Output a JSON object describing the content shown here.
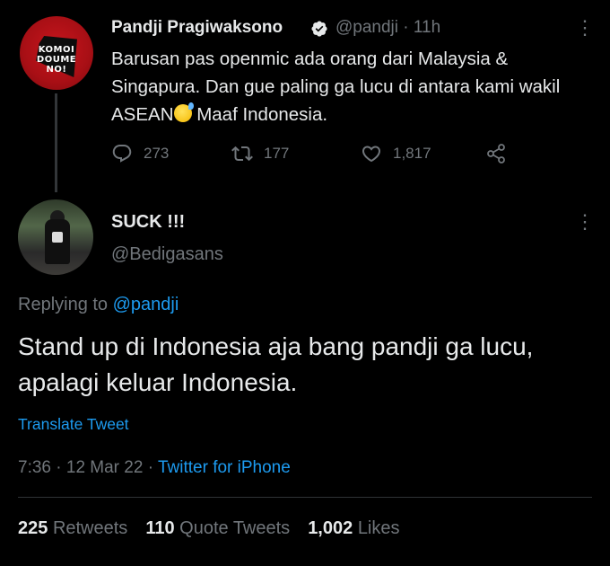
{
  "parent_tweet": {
    "avatar_lines": [
      "KOMOI",
      "DOUME",
      "NO!"
    ],
    "display_name": "Pandji Pragiwaksono",
    "handle": "@pandji",
    "time_sep": " · ",
    "time": "11h",
    "text_before_emoji": "Barusan pas openmic ada orang dari Malaysia & Singapura. Dan gue paling ga lucu di antara kami wakil ASEAN",
    "emoji": "sweat-smile-emoji",
    "text_after_emoji": " Maaf Indonesia.",
    "reply_count": "273",
    "retweet_count": "177",
    "like_count": "1,817"
  },
  "reply_tweet": {
    "display_name": "SUCK !!!",
    "handle": "@Bedigasans",
    "replying_prefix": "Replying to ",
    "replying_handle": "@pandji",
    "text": "Stand up di Indonesia aja bang pandji ga lucu, apalagi keluar Indonesia.",
    "translate_label": "Translate Tweet",
    "time": "7:36",
    "date": "12 Mar 22",
    "sep": " · ",
    "source": "Twitter for iPhone"
  },
  "stats": {
    "retweets_count": "225",
    "retweets_label": "Retweets",
    "quotes_count": "110",
    "quotes_label": "Quote Tweets",
    "likes_count": "1,002",
    "likes_label": "Likes"
  },
  "colors": {
    "background": "#000000",
    "text": "#e7e9ea",
    "muted": "#71767b",
    "accent": "#1d9bf0"
  },
  "icons": [
    "more-icon",
    "verified-badge-icon",
    "reply-icon",
    "retweet-icon",
    "like-icon",
    "share-icon"
  ]
}
